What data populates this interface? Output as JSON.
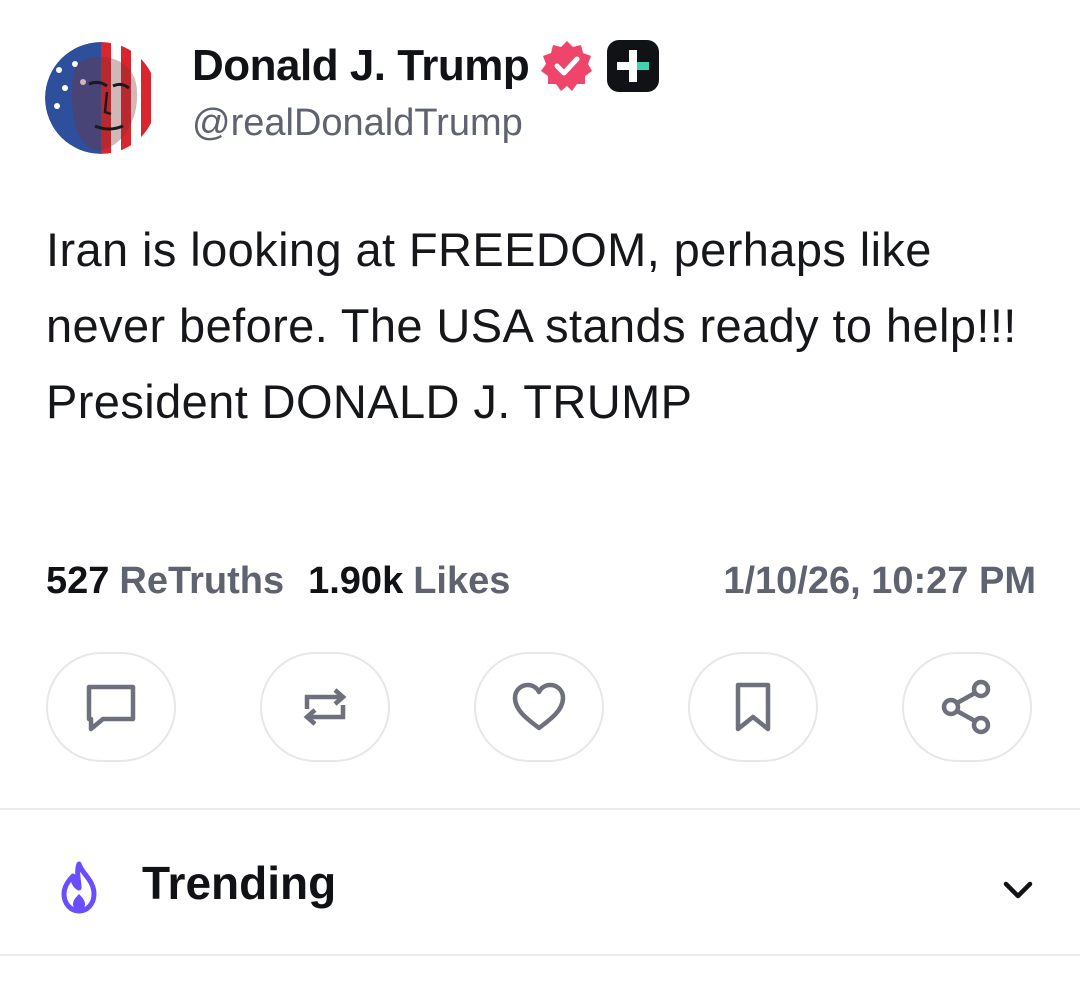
{
  "author": {
    "display_name": "Donald J. Trump",
    "handle": "@realDonaldTrump",
    "avatar_icon": "avatar-image",
    "verified_icon": "verified-badge-icon",
    "plus_icon": "truth-plus-badge-icon"
  },
  "post": {
    "text": "Iran is looking at FREEDOM, perhaps like never before. The USA stands ready to help!!! President DONALD J. TRUMP"
  },
  "stats": {
    "retruths_count": "527",
    "retruths_label": "ReTruths",
    "likes_count": "1.90k",
    "likes_label": "Likes",
    "timestamp": "1/10/26, 10:27 PM"
  },
  "actions": [
    {
      "name": "reply",
      "icon": "comment-icon"
    },
    {
      "name": "retruth",
      "icon": "repost-icon"
    },
    {
      "name": "like",
      "icon": "heart-icon"
    },
    {
      "name": "bookmark",
      "icon": "bookmark-icon"
    },
    {
      "name": "share",
      "icon": "share-icon"
    }
  ],
  "trending": {
    "label": "Trending",
    "icon": "flame-icon",
    "expand_icon": "chevron-down-icon"
  },
  "colors": {
    "verified": "#f0456a",
    "accent": "#6a4dff",
    "muted": "#5f6370"
  }
}
